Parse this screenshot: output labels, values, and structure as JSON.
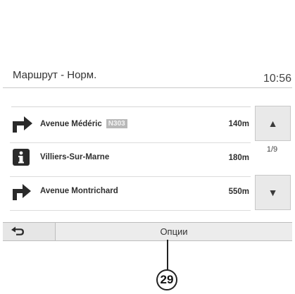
{
  "header": {
    "route_title": "Маршрут - Норм.",
    "clock": "10:56"
  },
  "route_steps": [
    {
      "icon": "turn-right-arrow-icon",
      "street": "Avenue Médéric",
      "road_badge": "N303",
      "distance": "140m"
    },
    {
      "icon": "info-icon",
      "street": "Villiers-Sur-Marne",
      "distance": "180m"
    },
    {
      "icon": "turn-right-arrow-icon",
      "street": "Avenue Montrichard",
      "distance": "550m"
    }
  ],
  "scroll": {
    "up_icon": "▲",
    "page_indicator": "1/9",
    "down_icon": "▼"
  },
  "bottom_bar": {
    "back_icon": "back-arrow-icon",
    "options_label": "Опции"
  },
  "callout": {
    "number": "29"
  }
}
